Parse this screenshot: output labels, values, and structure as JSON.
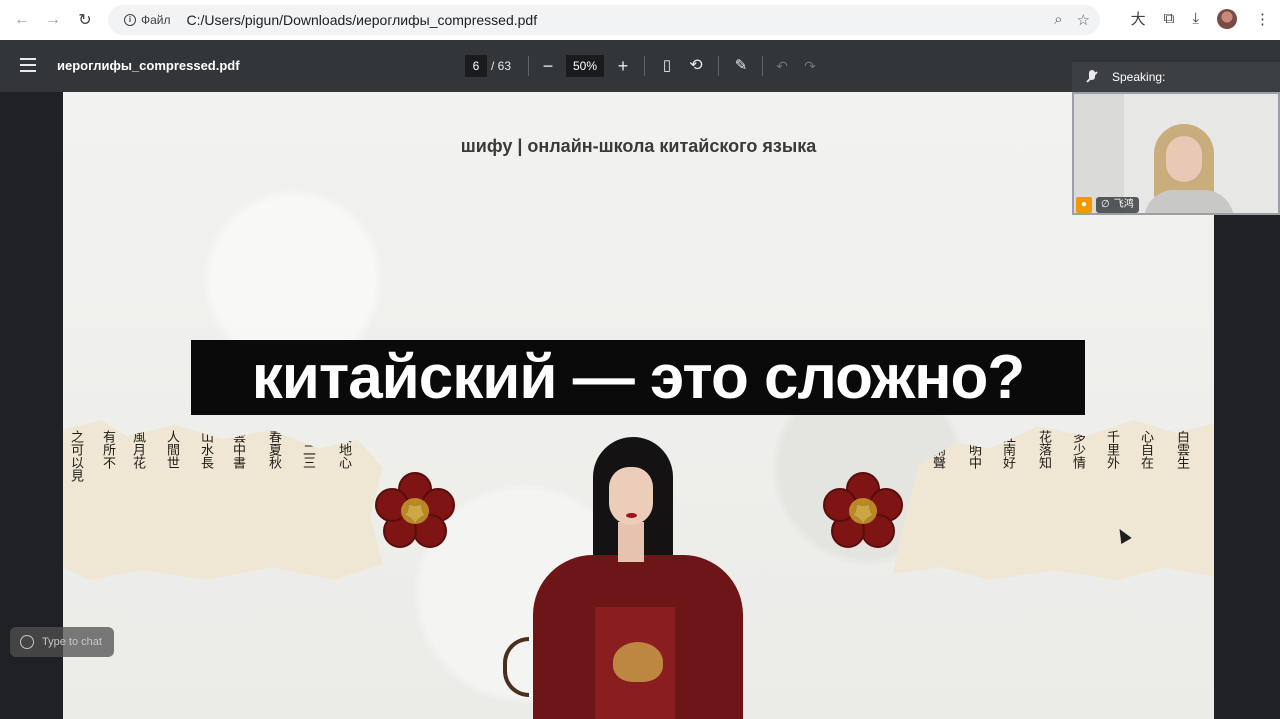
{
  "browser": {
    "site_info_label": "Файл",
    "url": "C:/Users/pigun/Downloads/иероглифы_compressed.pdf"
  },
  "pdf_toolbar": {
    "file_name": "иероглифы_compressed.pdf",
    "current_page": "6",
    "page_total": "/ 63",
    "zoom": "50%"
  },
  "page": {
    "subtitle": "шифу | онлайн-школа китайского языка",
    "headline": "китайский — это сложно?"
  },
  "call": {
    "speaking_label": "Speaking:",
    "participant_name": "飞鸿"
  },
  "chat": {
    "placeholder": "Type to chat"
  },
  "colors": {
    "pdf_toolbar_bg": "#323639",
    "headline_bg": "#0a0a0a",
    "flower_red": "#7e1414"
  }
}
